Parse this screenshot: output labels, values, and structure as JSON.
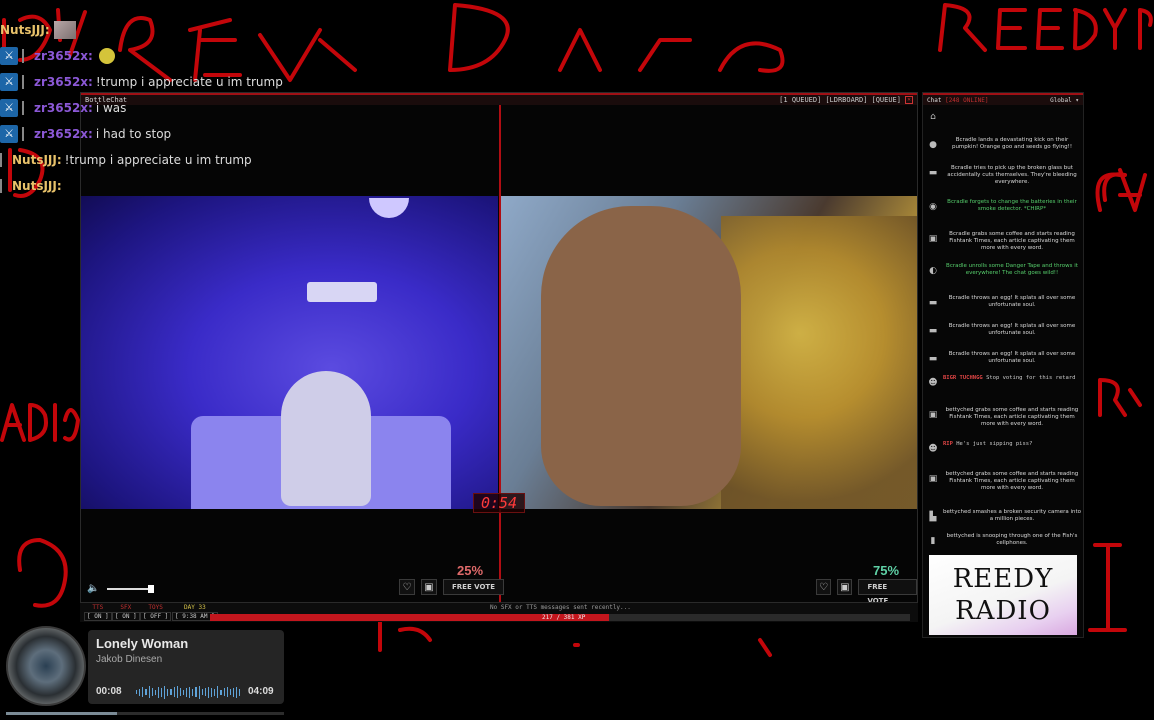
{
  "overlay_chat": [
    {
      "user": "NutsJJJ:",
      "message": "",
      "user_color": "nuts",
      "has_thumb": true,
      "has_badge": false
    },
    {
      "user": "zr3652x:",
      "message": "",
      "user_color": "zr",
      "has_emote": true,
      "has_badge": true
    },
    {
      "user": "zr3652x:",
      "message": "!trump i appreciate u im trump",
      "user_color": "zr",
      "has_badge": true
    },
    {
      "user": "zr3652x:",
      "message": "i was",
      "user_color": "zr",
      "has_badge": true
    },
    {
      "user": "zr3652x:",
      "message": "i had to stop",
      "user_color": "zr",
      "has_badge": true
    },
    {
      "user": "NutsJJJ:",
      "message": "!trump i appreciate u im trump",
      "user_color": "nuts",
      "has_badge": false
    },
    {
      "user": "NutsJJJ:",
      "message": "",
      "user_color": "nuts",
      "has_badge": false
    }
  ],
  "stream": {
    "title": "BottleChat",
    "queue_items": [
      "[1 QUEUED]",
      "[LDRBOARD]",
      "[QUEUE]"
    ],
    "timer": "0:54",
    "left_percent": "25%",
    "right_percent": "75%",
    "free_vote_label": "FREE VOTE"
  },
  "status_bar": {
    "stats": [
      {
        "label": "TTS",
        "value": "[ ON ]"
      },
      {
        "label": "SFX",
        "value": "[ ON ]"
      },
      {
        "label": "TOYS",
        "value": "[ OFF ]"
      },
      {
        "label": "DAY 33",
        "value": "[ 9:38 AM ]"
      }
    ],
    "sfx_message": "No SFX or TTS messages sent recently...",
    "xp_text": "217 / 381 XP",
    "xp_fraction": 0.57
  },
  "chat": {
    "title": "Chat",
    "online": "[248 ONLINE]",
    "scope": "Global",
    "items": [
      {
        "icon": "⌂",
        "text": "",
        "type": "normal"
      },
      {
        "icon": "●",
        "text": "Bcradle lands a devastating kick on their pumpkin! Orange goo and seeds go flying!!",
        "type": "normal"
      },
      {
        "icon": "▬",
        "text": "Bcradle tries to pick up the broken glass but accidentally cuts themselves. They're bleeding everywhere.",
        "type": "normal"
      },
      {
        "icon": "◉",
        "text": "Bcradle forgets to change the batteries in their smoke detector. *CHIRP*",
        "type": "green"
      },
      {
        "icon": "▣",
        "text": "Bcradle grabs some coffee and starts reading Fishtank Times, each article captivating them more with every word.",
        "type": "normal"
      },
      {
        "icon": "◐",
        "text": "Bcradle unrolls some Danger Tape and throws it everywhere! The chat goes wild!!",
        "type": "green"
      },
      {
        "icon": "▬",
        "text": "Bcradle throws an egg! It splats all over some unfortunate soul.",
        "type": "normal"
      },
      {
        "icon": "▬",
        "text": "Bcradle throws an egg! It splats all over some unfortunate soul.",
        "type": "normal"
      },
      {
        "icon": "▬",
        "text": "Bcradle throws an egg! It splats all over some unfortunate soul.",
        "type": "normal"
      },
      {
        "icon": "☻",
        "name": "BIGR TUCHNGG",
        "text": "Stop voting for this retard",
        "type": "user"
      },
      {
        "icon": "▣",
        "text": "bettyched grabs some coffee and starts reading Fishtank Times, each article captivating them more with every word.",
        "type": "normal"
      },
      {
        "icon": "☻",
        "name": "RIP",
        "text": "He's just sipping piss?",
        "type": "user"
      },
      {
        "icon": "▣",
        "text": "bettyched grabs some coffee and starts reading Fishtank Times, each article captivating them more with every word.",
        "type": "normal"
      },
      {
        "icon": "▙",
        "text": "bettyched smashes a broken security camera into a million pieces.",
        "type": "normal"
      },
      {
        "icon": "▮",
        "text": "bettyched is snooping through one of the Fish's cellphones.",
        "type": "normal"
      }
    ],
    "logo_line1": "REEDY",
    "logo_line2": "RADIO"
  },
  "now_playing": {
    "title": "Lonely Woman",
    "artist": "Jakob Dinesen",
    "elapsed": "00:08",
    "total": "04:09"
  }
}
